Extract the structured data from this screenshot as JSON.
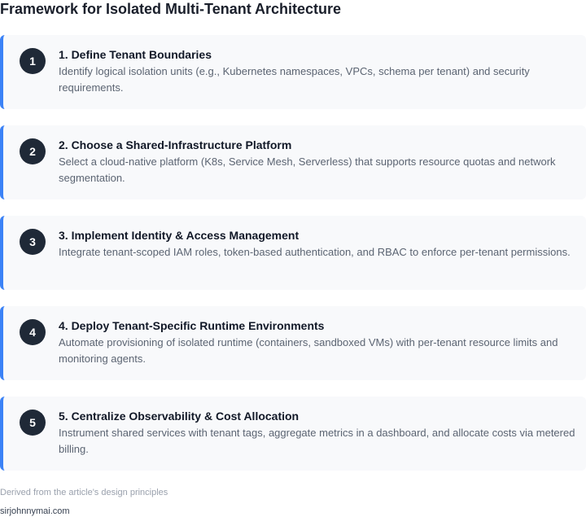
{
  "title": "Framework for Isolated Multi-Tenant Architecture",
  "steps": [
    {
      "number": "1",
      "title": "1. Define Tenant Boundaries",
      "description": "Identify logical isolation units (e.g., Kubernetes namespaces, VPCs, schema per tenant) and security requirements."
    },
    {
      "number": "2",
      "title": "2. Choose a Shared-Infrastructure Platform",
      "description": "Select a cloud-native platform (K8s, Service Mesh, Serverless) that supports resource quotas and network segmentation."
    },
    {
      "number": "3",
      "title": "3. Implement Identity & Access Management",
      "description": "Integrate tenant-scoped IAM roles, token-based authentication, and RBAC to enforce per-tenant permissions."
    },
    {
      "number": "4",
      "title": "4. Deploy Tenant-Specific Runtime Environments",
      "description": "Automate provisioning of isolated runtime (containers, sandboxed VMs) with per-tenant resource limits and monitoring agents."
    },
    {
      "number": "5",
      "title": "5. Centralize Observability & Cost Allocation",
      "description": "Instrument shared services with tenant tags, aggregate metrics in a dashboard, and allocate costs via metered billing."
    }
  ],
  "footnote": "Derived from the article's design principles",
  "site": "sirjohnnymai.com",
  "colors": {
    "accent": "#3b82f6",
    "badge": "#1f2937",
    "card_background": "#f8f9fb"
  }
}
